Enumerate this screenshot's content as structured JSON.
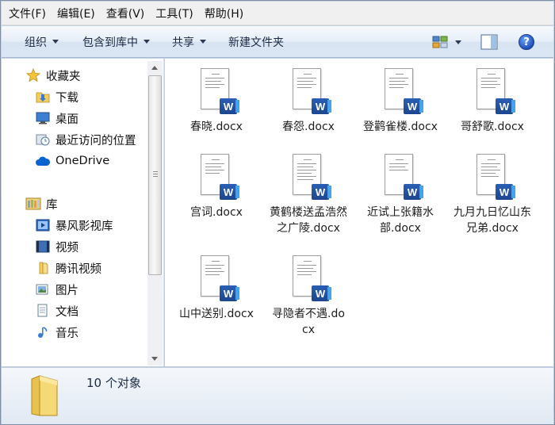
{
  "menubar": {
    "items": [
      "文件(F)",
      "编辑(E)",
      "查看(V)",
      "工具(T)",
      "帮助(H)"
    ]
  },
  "toolbar": {
    "organize": "组织",
    "include_in_library": "包含到库中",
    "share": "共享",
    "new_folder": "新建文件夹",
    "help": "?"
  },
  "nav": {
    "favorites": {
      "label": "收藏夹",
      "items": [
        "下载",
        "桌面",
        "最近访问的位置"
      ]
    },
    "onedrive": "OneDrive",
    "libraries": {
      "label": "库",
      "items": [
        "暴风影视库",
        "视频",
        "腾讯视频",
        "图片",
        "文档",
        "音乐"
      ]
    }
  },
  "files": [
    "春晓.docx",
    "春怨.docx",
    "登鹳雀楼.docx",
    "哥舒歌.docx",
    "宫词.docx",
    "黄鹤楼送孟浩然之广陵.docx",
    "近试上张籍水部.docx",
    "九月九日忆山东兄弟.docx",
    "山中送别.docx",
    "寻隐者不遇.docx"
  ],
  "file_icon_badge": "W",
  "details": {
    "count": "10 个对象"
  },
  "colors": {
    "toolbar_text": "#1b2b45",
    "word_blue": "#2b5fb4",
    "onedrive_blue": "#0a64d0"
  }
}
